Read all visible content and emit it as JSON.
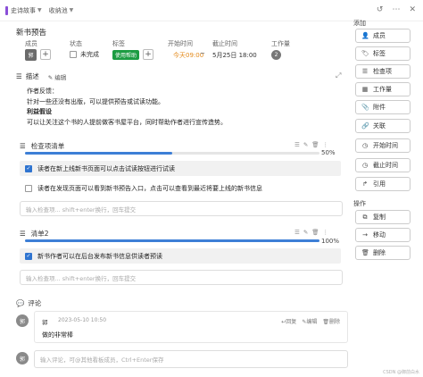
{
  "breadcrumb": {
    "board": "史诗故事",
    "list": "收纳池"
  },
  "card": {
    "title": "新书预告"
  },
  "meta": {
    "labels": {
      "members": "成员",
      "status": "状态",
      "tags": "标签",
      "start": "开始时间",
      "end": "截止时间",
      "workload": "工作量"
    },
    "member_initial": "郭",
    "status_value": "未完成",
    "tag": "使用帮助",
    "start_date": "今天09:00",
    "arrow": "~",
    "end_date": "5月25日 18:00",
    "workload": "2"
  },
  "description": {
    "heading": "描述",
    "edit": "编辑",
    "lines": [
      "作者反馈：",
      "针对一些还没有出版，可以提供预告或试读功能。",
      "利益假设",
      "可以让关注这个书的人提前做客书屋平台，同时帮助作者进行宣传造势。"
    ]
  },
  "checklists": [
    {
      "title": "检查项清单",
      "percent": "50%",
      "progress": 0.5,
      "items": [
        {
          "text": "读者在新上线新书页面可以点击试读按钮进行试读",
          "checked": true
        },
        {
          "text": "读者在发现页面可以看到新书预告入口，点击可以查看到最近将要上线的新书信息",
          "checked": false
        }
      ],
      "placeholder": "输入检查项... shift+enter换行，回车提交"
    },
    {
      "title": "清单2",
      "percent": "100%",
      "progress": 1.0,
      "items": [
        {
          "text": "新书作者可以在后台发布新书信息供读者预读",
          "checked": true
        }
      ],
      "placeholder": "输入检查项... shift+enter换行，回车提交"
    }
  ],
  "comments": {
    "heading": "评论",
    "entries": [
      {
        "author": "郭",
        "time": "2023-05-10 10:50",
        "text": "做的非常棒",
        "actions": [
          "回复",
          "编辑",
          "删除"
        ]
      }
    ],
    "input_avatar": "郭",
    "placeholder": "输入评论，可@其他看板成员，Ctrl+Enter保存"
  },
  "sidebar": {
    "add_heading": "添加",
    "add_buttons": [
      "成员",
      "标签",
      "检查项",
      "工作量",
      "附件",
      "关联",
      "开始时间",
      "截止时间",
      "引用"
    ],
    "ops_heading": "操作",
    "op_buttons": [
      "复制",
      "移动",
      "删除"
    ]
  },
  "watermark": "CSDN @御前白水",
  "colors": {
    "accent_blue": "#3d7fd6",
    "tag_green": "#1c9c42",
    "start_orange": "#e48a1a",
    "board_purple": "#8a4fd8"
  }
}
